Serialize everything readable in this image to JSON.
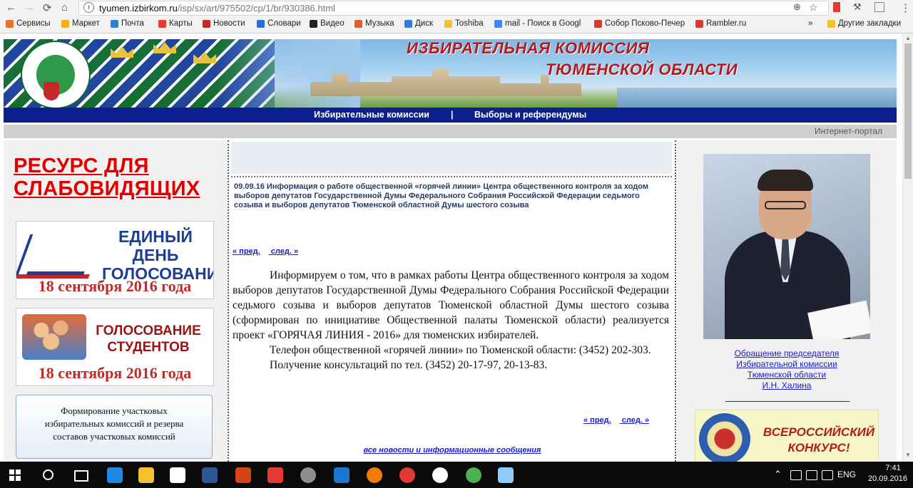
{
  "browser": {
    "url_host": "tyumen.izbirkom.ru",
    "url_path": "/isp/sx/art/975502/cp/1/br/930386.html",
    "bookmarks": [
      {
        "label": "Сервисы",
        "color": "#e8712b"
      },
      {
        "label": "Маркет",
        "color": "#f2b01e"
      },
      {
        "label": "Почта",
        "color": "#2a7fd9"
      },
      {
        "label": "Карты",
        "color": "#e53935"
      },
      {
        "label": "Новости",
        "color": "#c62828"
      },
      {
        "label": "Словари",
        "color": "#2f6bd6"
      },
      {
        "label": "Видео",
        "color": "#222222"
      },
      {
        "label": "Музыка",
        "color": "#e35d2d"
      },
      {
        "label": "Диск",
        "color": "#2e7dd7"
      },
      {
        "label": "Toshiba",
        "color": "#f1c232"
      },
      {
        "label": "mail - Поиск в Googl",
        "color": "#4285f4"
      },
      {
        "label": "Собор Псково-Печер",
        "color": "#d63b2f"
      },
      {
        "label": "Rambler.ru",
        "color": "#d63b2f"
      }
    ],
    "bookmarks_more": "»",
    "other_bookmarks": "Другие закладки"
  },
  "header": {
    "title_line1": "ИЗБИРАТЕЛЬНАЯ КОМИССИЯ",
    "title_line2": "ТЮМЕНСКОЙ ОБЛАСТИ"
  },
  "nav": {
    "link1": "Избирательные комиссии",
    "separator": "|",
    "link2": "Выборы и референдумы"
  },
  "portal_label": "Интернет-портал",
  "left": {
    "resource_link_line1": "РЕСУРС ДЛЯ",
    "resource_link_line2": "СЛАБОВИДЯЩИХ",
    "promo1_line1": "ЕДИНЫЙ ДЕНЬ",
    "promo1_line2": "ГОЛОСОВАНИЯ",
    "promo1_date": "18 сентября 2016 года",
    "promo2_line1": "ГОЛОСОВАНИЕ",
    "promo2_line2": "СТУДЕНТОВ",
    "promo2_date": "18 сентября 2016 года",
    "promo3_line1": "Формирование участковых",
    "promo3_line2": "избирательных комиссий и резерва",
    "promo3_line3": "составов участковых комиссий"
  },
  "center": {
    "news_title": "09.09.16 Информация о работе общественной «горячей линии» Центра общественного контроля за ходом выборов депутатов Государственной Думы Федерального Собрания Российской Федерации седьмого созыва и выборов депутатов Тюменской областной Думы шестого созыва",
    "prev": "« пред.",
    "next": "след. »",
    "paragraph1": "Информируем о том, что в рамках работы Центра общественного контроля за ходом выборов депутатов Государственной Думы Федерального Собрания Российской Федерации седьмого созыва и выборов депутатов Тюменской областной Думы шестого созыва (сформирован по инициативе Общественной палаты Тюменской области) реализуется проект «ГОРЯЧАЯ ЛИНИЯ - 2016» для тюменских избирателей.",
    "paragraph2": "Телефон общественной «горячей линии» по Тюменской области: (3452) 202-303.",
    "paragraph3": "Получение консультаций по тел. (3452) 20-17-97, 20-13-83.",
    "all_news": "все новости и информационные сообщения"
  },
  "right": {
    "appeal_line1": "Обращение председателя",
    "appeal_line2": "Избирательной комиссии",
    "appeal_line3": "Тюменской области",
    "appeal_line4": "И.Н. Халина",
    "contest_line1": "ВСЕРОССИЙСКИЙ",
    "contest_line2": "КОНКУРС!"
  },
  "taskbar": {
    "language": "ENG",
    "time": "7:41",
    "date": "20.09.2016",
    "apps": [
      {
        "name": "edge",
        "color": "#1e88e5"
      },
      {
        "name": "explorer",
        "color": "#f2c230"
      },
      {
        "name": "store",
        "color": "#ffffff"
      },
      {
        "name": "word",
        "color": "#2b5797"
      },
      {
        "name": "video",
        "color": "#d84315"
      },
      {
        "name": "yandex",
        "color": "#e53935"
      },
      {
        "name": "app-circle",
        "color": "#8d8d8d"
      },
      {
        "name": "mail",
        "color": "#1976d2"
      },
      {
        "name": "firefox",
        "color": "#f57c00"
      },
      {
        "name": "opera",
        "color": "#e53935"
      },
      {
        "name": "yandex-browser",
        "color": "#ffffff"
      },
      {
        "name": "chrome",
        "color": "#4caf50"
      },
      {
        "name": "paint",
        "color": "#90caf9"
      }
    ]
  }
}
